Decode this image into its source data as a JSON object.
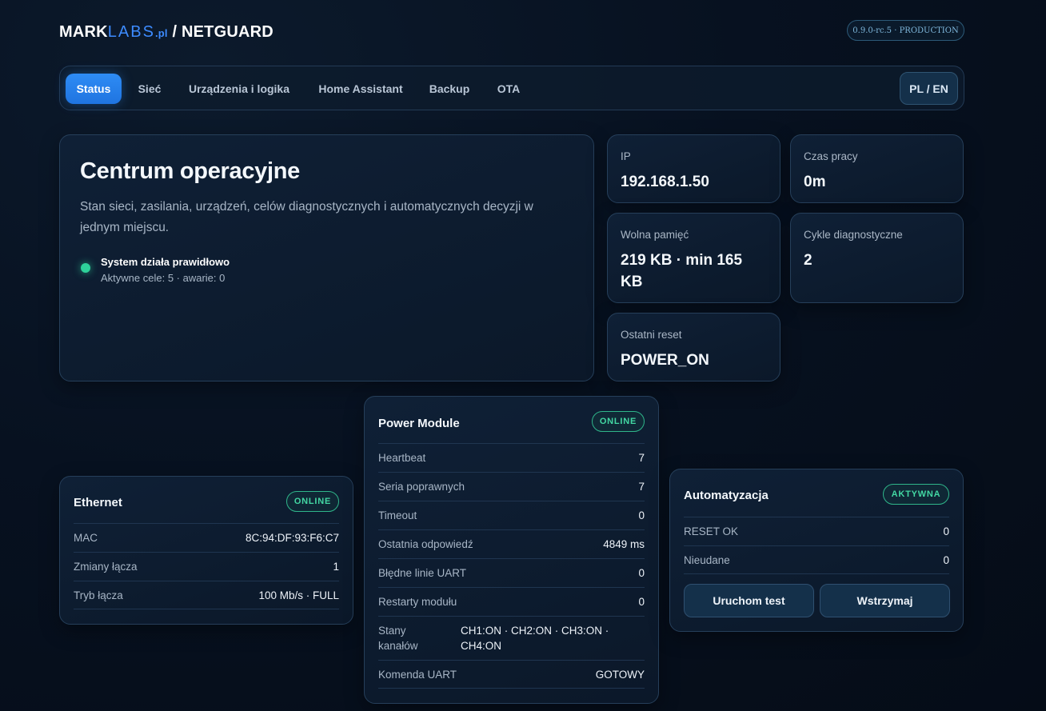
{
  "brand": {
    "mark": "MARK",
    "labs": "LABS",
    "pl": ".pl",
    "product": " / NETGUARD"
  },
  "version": "0.9.0-rc.5 · PRODUCTION",
  "nav": {
    "tabs": [
      "Status",
      "Sieć",
      "Urządzenia i logika",
      "Home Assistant",
      "Backup",
      "OTA"
    ],
    "active": "Status",
    "lang": "PL / EN"
  },
  "hero": {
    "title": "Centrum operacyjne",
    "description": "Stan sieci, zasilania, urządzeń, celów diagnostycznych i automatycznych decyzji w jednym miejscu.",
    "status_title": "System działa prawidłowo",
    "status_sub": "Aktywne cele: 5 · awarie: 0"
  },
  "stats": {
    "ip": {
      "label": "IP",
      "value": "192.168.1.50"
    },
    "uptime": {
      "label": "Czas pracy",
      "value": "0m"
    },
    "memory": {
      "label": "Wolna pamięć",
      "value": "219 KB · min 165 KB"
    },
    "cycles": {
      "label": "Cykle diagnostyczne",
      "value": "2"
    },
    "reset": {
      "label": "Ostatni reset",
      "value": "POWER_ON"
    }
  },
  "ethernet": {
    "title": "Ethernet",
    "badge": "ONLINE",
    "rows": [
      {
        "k": "MAC",
        "v": "8C:94:DF:93:F6:C7"
      },
      {
        "k": "Zmiany łącza",
        "v": "1"
      },
      {
        "k": "Tryb łącza",
        "v": "100 Mb/s · FULL"
      }
    ]
  },
  "power": {
    "title": "Power Module",
    "badge": "ONLINE",
    "rows": [
      {
        "k": "Heartbeat",
        "v": "7"
      },
      {
        "k": "Seria poprawnych",
        "v": "7"
      },
      {
        "k": "Timeout",
        "v": "0"
      },
      {
        "k": "Ostatnia odpowiedź",
        "v": "4849 ms"
      },
      {
        "k": "Błędne linie UART",
        "v": "0"
      },
      {
        "k": "Restarty modułu",
        "v": "0"
      },
      {
        "k": "Stany kanałów",
        "v": "CH1:ON · CH2:ON · CH3:ON · CH4:ON"
      },
      {
        "k": "Komenda UART",
        "v": "GOTOWY"
      }
    ]
  },
  "automation": {
    "title": "Automatyzacja",
    "badge": "AKTYWNA",
    "rows": [
      {
        "k": "RESET OK",
        "v": "0"
      },
      {
        "k": "Nieudane",
        "v": "0"
      }
    ],
    "run_test": "Uruchom test",
    "pause": "Wstrzymaj"
  },
  "colors": {
    "accent": "#2e8cf5",
    "online": "#43d8a3",
    "background": "#071120",
    "card": "#0f2036"
  }
}
